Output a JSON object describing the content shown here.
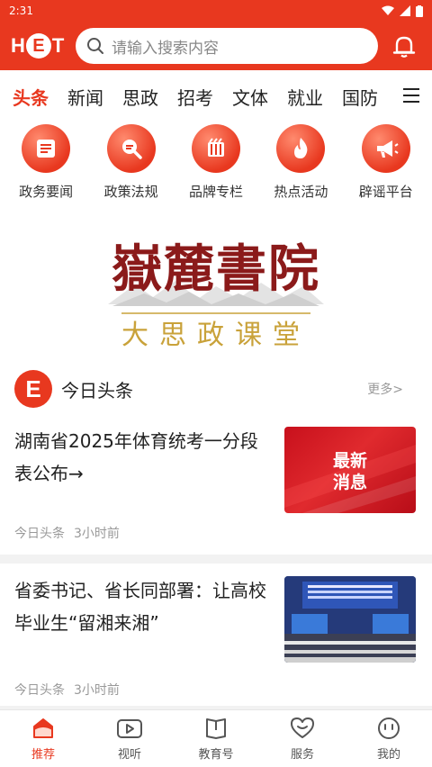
{
  "status_bar": {
    "time": "2:31"
  },
  "header": {
    "logo_letters": [
      "H",
      "E",
      "T"
    ],
    "search_placeholder": "请输入搜索内容"
  },
  "tabs": [
    {
      "label": "头条",
      "active": true
    },
    {
      "label": "新闻"
    },
    {
      "label": "思政"
    },
    {
      "label": "招考"
    },
    {
      "label": "文体"
    },
    {
      "label": "就业"
    },
    {
      "label": "国防"
    }
  ],
  "quick_links": [
    {
      "label": "政务要闻",
      "icon": "document-icon"
    },
    {
      "label": "政策法规",
      "icon": "magnifier-icon"
    },
    {
      "label": "品牌专栏",
      "icon": "columns-icon"
    },
    {
      "label": "热点活动",
      "icon": "flame-icon"
    },
    {
      "label": "辟谣平台",
      "icon": "megaphone-icon"
    }
  ],
  "banner": {
    "title": "嶽麓書院",
    "subtitle": "大思政课堂"
  },
  "section": {
    "logo_letter": "E",
    "title": "今日头条",
    "more": "更多>"
  },
  "articles": [
    {
      "title": "湖南省2025年体育统考一分段表公布→",
      "source": "今日头条",
      "time": "3小时前",
      "thumb_text": [
        "最新",
        "消息"
      ]
    },
    {
      "title": "省委书记、省长同部署：让高校毕业生“留湘来湘”",
      "source": "今日头条",
      "time": "3小时前"
    }
  ],
  "bottom_nav": [
    {
      "label": "推荐",
      "icon": "home-icon",
      "active": true
    },
    {
      "label": "视听",
      "icon": "video-icon"
    },
    {
      "label": "教育号",
      "icon": "book-icon"
    },
    {
      "label": "服务",
      "icon": "heart-icon"
    },
    {
      "label": "我的",
      "icon": "profile-icon"
    }
  ],
  "colors": {
    "brand": "#e8381f",
    "gold": "#c9a23a",
    "crimson": "#8b1a1a"
  }
}
